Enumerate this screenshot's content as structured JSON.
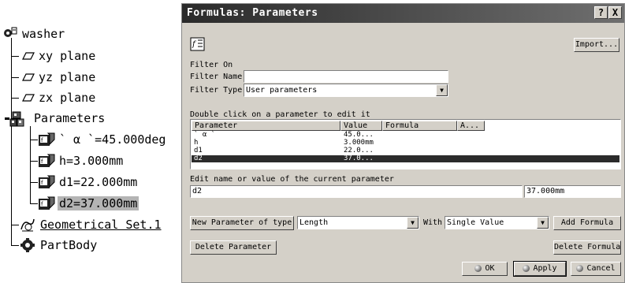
{
  "tree": {
    "root": "washer",
    "planes": [
      "xy plane",
      "yz plane",
      "zx plane"
    ],
    "parameters_label": "Parameters",
    "params": [
      "` α `=45.000deg",
      "h=3.000mm",
      "d1=22.000mm",
      "d2=37.000mm"
    ],
    "geo_set": "Geometrical Set.1",
    "part_body": "PartBody"
  },
  "dialog": {
    "title": "Formulas: Parameters",
    "help_btn": "?",
    "close_btn": "X",
    "import_btn": "Import...",
    "filter_on": "Filter On",
    "filter_name_label": "Filter Name :",
    "filter_name_value": "",
    "filter_type_label": "Filter Type :",
    "filter_type_value": "User parameters",
    "double_click_hint": "Double click on a parameter to edit it",
    "columns": [
      "Parameter",
      "Value",
      "Formula",
      "A..."
    ],
    "rows": [
      {
        "param": "` α `",
        "value": "45.0..."
      },
      {
        "param": "h",
        "value": "3.000mm"
      },
      {
        "param": "d1",
        "value": "22.0..."
      },
      {
        "param": "d2",
        "value": "37.0..."
      }
    ],
    "edit_label": "Edit name or value of the current parameter",
    "edit_name": "d2",
    "edit_value": "37.000mm",
    "new_param_btn": "New Parameter of type",
    "new_param_type": "Length",
    "with_label": "With",
    "with_value": "Single Value",
    "add_formula_btn": "Add Formula",
    "delete_param_btn": "Delete Parameter",
    "delete_formula_btn": "Delete Formula",
    "ok_btn": "OK",
    "apply_btn": "Apply",
    "cancel_btn": "Cancel"
  }
}
